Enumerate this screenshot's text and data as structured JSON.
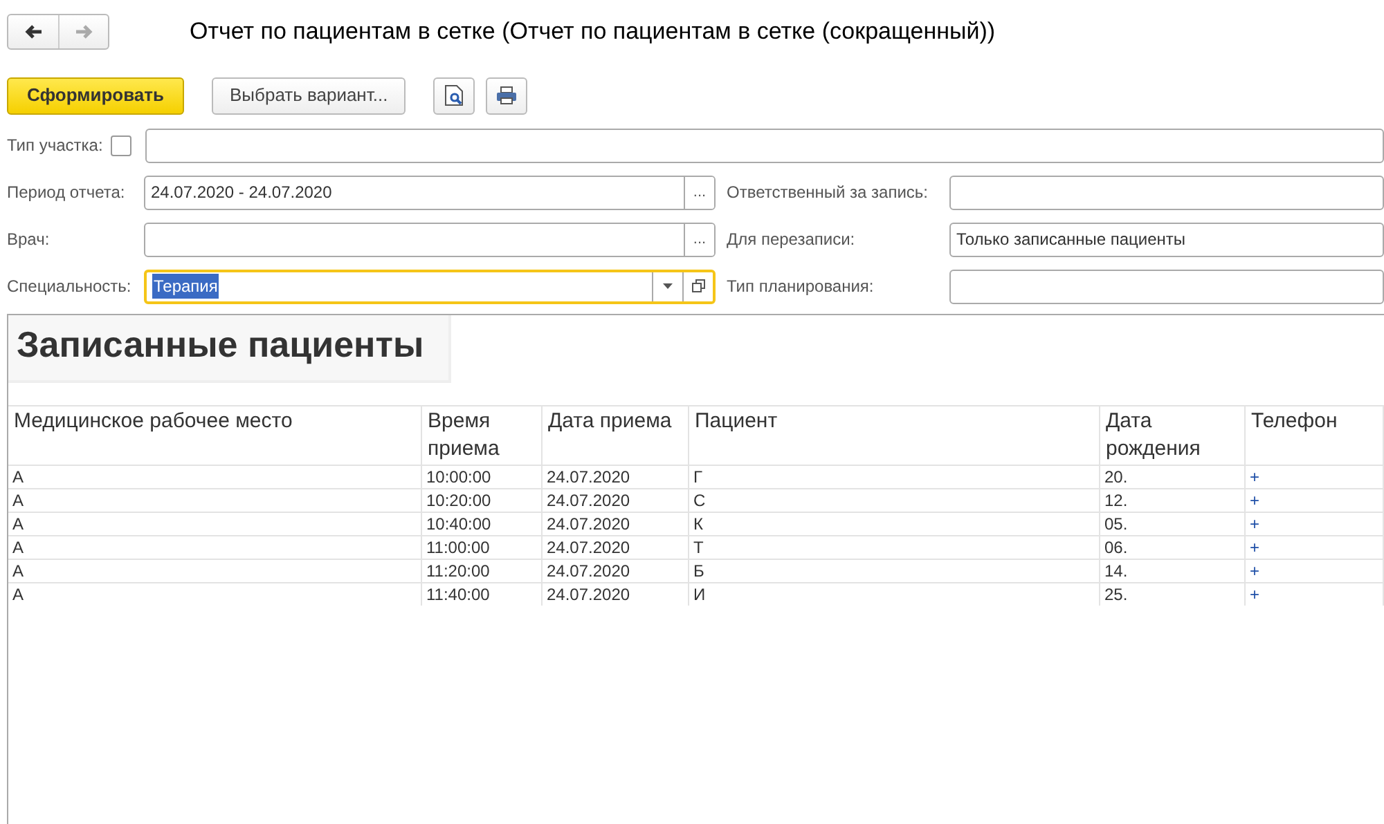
{
  "window": {
    "title": "Отчет по пациентам в сетке (Отчет по пациентам в сетке (сокращенный))"
  },
  "nav": {
    "back_disabled": false,
    "forward_disabled": true
  },
  "toolbar": {
    "generate": "Сформировать",
    "choose_variant": "Выбрать вариант..."
  },
  "filters": {
    "site_type": {
      "label": "Тип участка:",
      "checked": false
    },
    "period": {
      "label": "Период отчета:",
      "value": "24.07.2020 - 24.07.2020",
      "button": "..."
    },
    "doctor": {
      "label": "Врач:",
      "button": "..."
    },
    "specialty": {
      "label": "Специальность:",
      "value": "Терапия",
      "focused": true
    },
    "responsible": {
      "label": "Ответственный за запись:"
    },
    "rebooking": {
      "label": "Для перезаписи:",
      "value": "Только записанные пациенты"
    },
    "planning_type": {
      "label": "Тип планирования:"
    }
  },
  "report": {
    "title": "Записанные пациенты",
    "columns": [
      "Медицинское рабочее место",
      "Время приема",
      "Дата приема",
      "Пациент",
      "Дата рождения",
      "Телефон"
    ],
    "rows": [
      [
        "А",
        "10:00:00",
        "24.07.2020",
        "Г",
        "20.",
        "+"
      ],
      [
        "А",
        "10:20:00",
        "24.07.2020",
        "С",
        "12.",
        "+"
      ],
      [
        "А",
        "10:40:00",
        "24.07.2020",
        "К",
        "05.",
        "+"
      ],
      [
        "А",
        "11:00:00",
        "24.07.2020",
        "Т",
        "06.",
        "+"
      ],
      [
        "А",
        "11:20:00",
        "24.07.2020",
        "Б",
        "14.",
        "+"
      ],
      [
        "А",
        "11:40:00",
        "24.07.2020",
        "И",
        "25.",
        "+"
      ]
    ]
  }
}
